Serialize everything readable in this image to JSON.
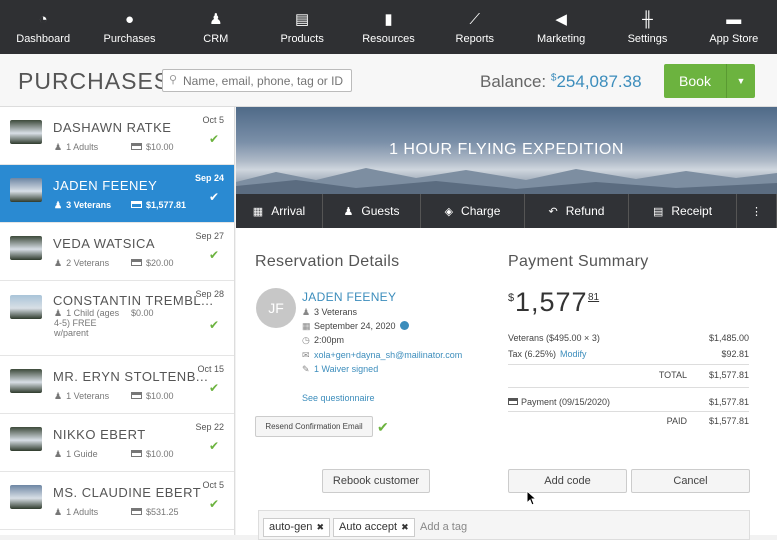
{
  "nav": [
    {
      "label": "Dashboard",
      "icon": "dashboard-icon",
      "glyph": "◔"
    },
    {
      "label": "Purchases",
      "icon": "piggy-bank-icon",
      "glyph": "●"
    },
    {
      "label": "CRM",
      "icon": "users-icon",
      "glyph": "♟"
    },
    {
      "label": "Products",
      "icon": "box-icon",
      "glyph": "▤"
    },
    {
      "label": "Resources",
      "icon": "clipboard-icon",
      "glyph": "▮"
    },
    {
      "label": "Reports",
      "icon": "chart-icon",
      "glyph": "⟋"
    },
    {
      "label": "Marketing",
      "icon": "megaphone-icon",
      "glyph": "◀"
    },
    {
      "label": "Settings",
      "icon": "sliders-icon",
      "glyph": "╫"
    },
    {
      "label": "App Store",
      "icon": "store-icon",
      "glyph": "▬"
    }
  ],
  "header": {
    "title": "PURCHASES",
    "search_placeholder": "Name, email, phone, tag or ID",
    "balance_label": "Balance:",
    "balance_currency": "$",
    "balance_amount": "254,087.38",
    "book_label": "Book"
  },
  "purchases": [
    {
      "name": "DASHAWN RATKE",
      "date": "Oct 5",
      "guests": "1 Adults",
      "price": "$10.00",
      "thumb": "#3d4a3a"
    },
    {
      "name": "JADEN FEENEY",
      "date": "Sep 24",
      "guests": "3 Veterans",
      "price": "$1,577.81",
      "thumb": "#6d86a3",
      "active": true
    },
    {
      "name": "VEDA WATSICA",
      "date": "Sep 27",
      "guests": "2 Veterans",
      "price": "$20.00",
      "thumb": "#3d4a3a"
    },
    {
      "name": "CONSTANTIN TREMBL...",
      "date": "Sep 28",
      "guests": "1 Child (ages 4-5) FREE w/parent",
      "price": "$0.00",
      "thumb": "#a9c4d8"
    },
    {
      "name": "MR. ERYN STOLTENB...",
      "date": "Oct 15",
      "guests": "1 Veterans",
      "price": "$10.00",
      "thumb": "#3d4a3a"
    },
    {
      "name": "NIKKO EBERT",
      "date": "Sep 22",
      "guests": "1 Guide",
      "price": "$10.00",
      "thumb": "#3d4a3a"
    },
    {
      "name": "MS. CLAUDINE EBERT",
      "date": "Oct 5",
      "guests": "1 Adults",
      "price": "$531.25",
      "thumb": "#6d86a3"
    }
  ],
  "banner_title": "1 HOUR FLYING EXPEDITION",
  "actions": [
    {
      "label": "Arrival",
      "icon": "calendar-icon",
      "glyph": "▦"
    },
    {
      "label": "Guests",
      "icon": "guests-icon",
      "glyph": "♟"
    },
    {
      "label": "Charge",
      "icon": "tag-icon",
      "glyph": "◈"
    },
    {
      "label": "Refund",
      "icon": "undo-icon",
      "glyph": "↶"
    },
    {
      "label": "Receipt",
      "icon": "receipt-icon",
      "glyph": "▤"
    },
    {
      "label": "",
      "icon": "more-icon",
      "glyph": "⋮"
    }
  ],
  "reservation": {
    "title": "Reservation Details",
    "initials": "JF",
    "customer_name": "JADEN FEENEY",
    "guests": "3 Veterans",
    "date": "September 24, 2020",
    "time": "2:00pm",
    "email": "xola+gen+dayna_sh@mailinator.com",
    "waiver": "1 Waiver signed",
    "questionnaire": "See questionnaire",
    "resend_label": "Resend Confirmation Email",
    "rebook_label": "Rebook customer"
  },
  "payment": {
    "title": "Payment Summary",
    "total_currency": "$",
    "total_whole": "1,577",
    "total_cents": "81",
    "line_item_label": "Veterans ($495.00 × 3)",
    "line_item_amount": "$1,485.00",
    "tax_label": "Tax (6.25%)",
    "tax_modify": "Modify",
    "tax_amount": "$92.81",
    "total_label": "TOTAL",
    "total_amount": "$1,577.81",
    "payment_label": "Payment (09/15/2020)",
    "payment_amount": "$1,577.81",
    "paid_label": "PAID",
    "paid_amount": "$1,577.81",
    "add_code_label": "Add code",
    "cancel_label": "Cancel"
  },
  "tags": {
    "items": [
      "auto-gen",
      "Auto accept"
    ],
    "placeholder": "Add a tag"
  }
}
